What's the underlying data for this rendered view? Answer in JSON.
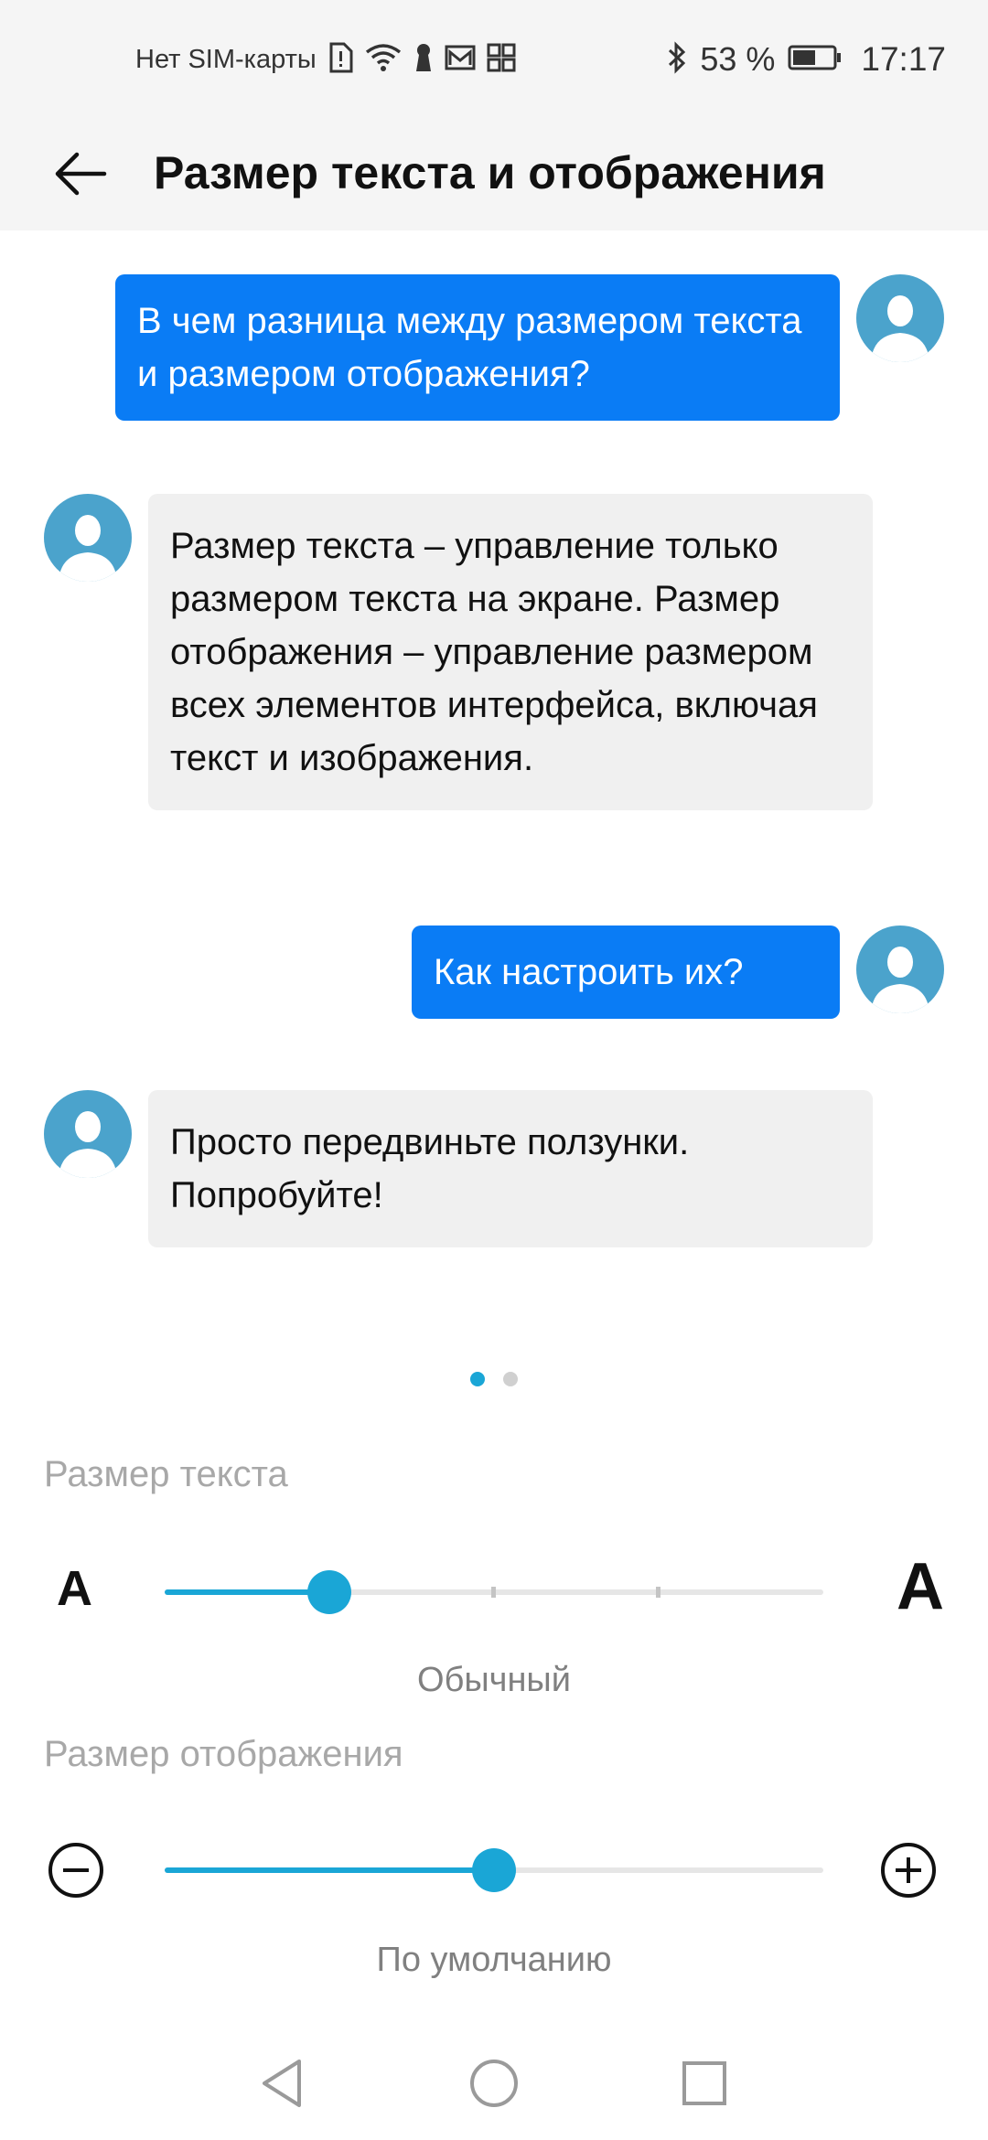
{
  "status_bar": {
    "carrier": "Нет SIM-карты",
    "battery_percent": "53 %",
    "time": "17:17",
    "icons": [
      "sim-alert-icon",
      "wifi-icon",
      "keyhole-icon",
      "mail-icon",
      "apps-icon",
      "bluetooth-icon",
      "battery-icon"
    ]
  },
  "header": {
    "title": "Размер текста и отображения",
    "back_icon": "arrow-back-icon"
  },
  "chat": {
    "messages": [
      {
        "sender": "user",
        "text": "В чем разница между размером текста и размером отображения?"
      },
      {
        "sender": "assistant",
        "text": "Размер текста – управление только размером текста на экране. Размер отображения – управление размером всех элементов интерфейса, включая текст и изображения."
      },
      {
        "sender": "user",
        "text": "Как настроить их?"
      },
      {
        "sender": "assistant",
        "text": "Просто передвиньте ползунки. Попробуйте!"
      }
    ]
  },
  "pager": {
    "count": 2,
    "active_index": 0
  },
  "text_size": {
    "label": "Размер текста",
    "small_glyph": "A",
    "large_glyph": "A",
    "value_label": "Обычный",
    "steps": 5,
    "current_step": 1
  },
  "display_size": {
    "label": "Размер отображения",
    "value_label": "По умолчанию",
    "level_fraction": 0.5,
    "decrease_icon": "minus-circle-icon",
    "increase_icon": "plus-circle-icon"
  },
  "navigation": {
    "icons": [
      "nav-back-icon",
      "nav-home-icon",
      "nav-recents-icon"
    ]
  },
  "colors": {
    "accent": "#1aa6d6",
    "user_bubble": "#0a7cf5",
    "bot_bubble": "#f0f0f0",
    "avatar": "#4ba3cc"
  }
}
